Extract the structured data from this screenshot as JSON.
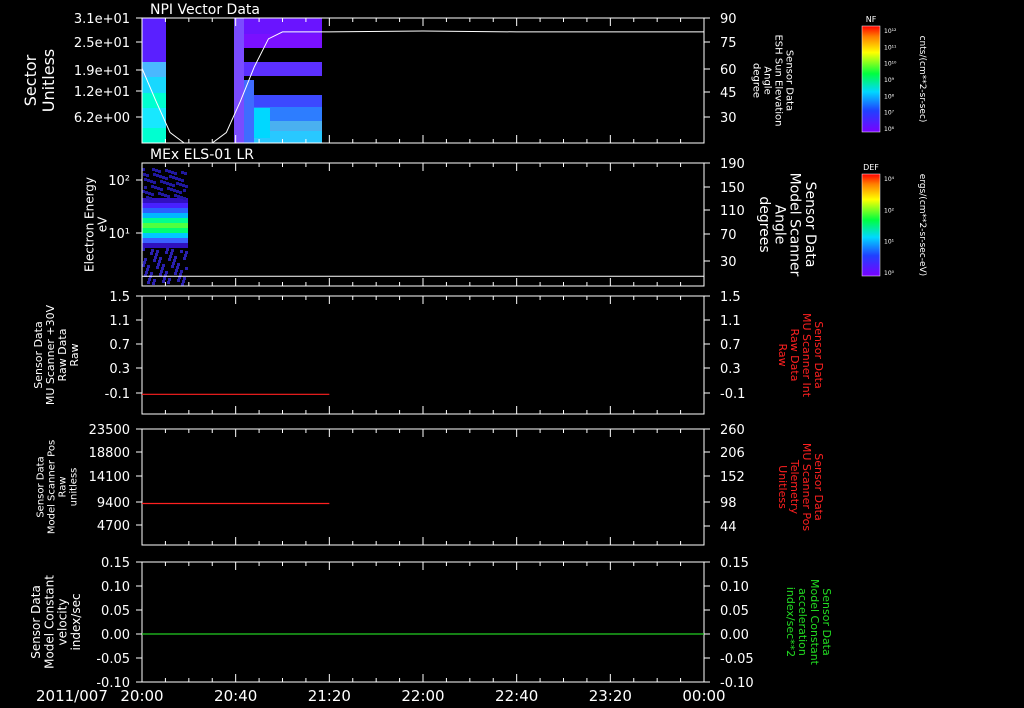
{
  "figure": {
    "date_label": "2011/007",
    "time_ticks": [
      "20:00",
      "20:40",
      "21:20",
      "22:00",
      "22:40",
      "23:20",
      "00:00"
    ]
  },
  "chart_data": [
    {
      "type": "heatmap",
      "title": "NPI Vector Data",
      "ylabel": [
        "Sector",
        "Unitless"
      ],
      "y_ticks": [
        "3.1e+01",
        "2.5e+01",
        "1.9e+01",
        "1.2e+01",
        "6.2e+00"
      ],
      "right_label": [
        "Sensor Data",
        "ESH Sun Elevation",
        "Angle",
        "degree"
      ],
      "right_ticks": [
        "90",
        "75",
        "60",
        "45",
        "30"
      ],
      "overlay_line": {
        "x": [
          "20:00",
          "20:06",
          "20:12",
          "20:18",
          "20:24",
          "20:30",
          "20:36",
          "20:42",
          "20:48",
          "20:54",
          "21:00",
          "21:20",
          "22:00",
          "22:40",
          "23:20",
          "00:00"
        ],
        "y": [
          61,
          42,
          24,
          18,
          18,
          18,
          24,
          42,
          62,
          78,
          82,
          82,
          82.5,
          82,
          82,
          82
        ],
        "ylim": [
          18,
          90
        ]
      },
      "colorbar": {
        "label": "NF",
        "units": "cnts/(cm**2-sr-sec)",
        "ticks": [
          "10¹²",
          "10¹¹",
          "10¹⁰",
          "10⁹",
          "10⁸",
          "10⁷",
          "10⁶"
        ]
      }
    },
    {
      "type": "heatmap",
      "title": "MEx ELS-01 LR",
      "ylabel": [
        "Electron Energy",
        "eV"
      ],
      "y_ticks": [
        "10²",
        "10¹"
      ],
      "right_label": [
        "Sensor Data",
        "Model Scanner",
        "Angle",
        "degrees"
      ],
      "right_ticks": [
        "190",
        "150",
        "110",
        "70",
        "30"
      ],
      "overlay_line": {
        "x": [
          "20:00",
          "00:00"
        ],
        "y": [
          15,
          15
        ],
        "ylim": [
          0,
          190
        ]
      },
      "colorbar": {
        "label": "DEF",
        "units": "ergs/(cm**2-sr-sec-eV)",
        "ticks": [
          "10⁴",
          "10²",
          "10¹",
          "10⁰"
        ]
      }
    },
    {
      "type": "line",
      "ylabel": [
        "Sensor Data",
        "MU Scanner +30V",
        "Raw Data",
        "Raw"
      ],
      "y_ticks": [
        "1.5",
        "1.1",
        "0.7",
        "0.3",
        "-0.1"
      ],
      "ylim": [
        -0.3,
        1.5
      ],
      "right_label": [
        "Sensor Data",
        "MU Scanner Int",
        "Raw Data",
        "Raw"
      ],
      "right_ticks": [
        "1.5",
        "1.1",
        "0.7",
        "0.3",
        "-0.1"
      ],
      "series": [
        {
          "x": [
            "20:00",
            "21:20"
          ],
          "y": [
            0.0,
            0.0
          ],
          "color": "#ff2020"
        }
      ]
    },
    {
      "type": "line",
      "ylabel": [
        "Sensor Data",
        "Model Scanner Pos",
        "Raw",
        "unitless"
      ],
      "y_ticks": [
        "23500",
        "18800",
        "14100",
        "9400",
        "4700"
      ],
      "ylim": [
        0,
        23500
      ],
      "right_label": [
        "Sensor Data",
        "MU Scanner Pos",
        "Telemetry",
        "Unitless"
      ],
      "right_ticks": [
        "260",
        "206",
        "152",
        "98",
        "44"
      ],
      "series": [
        {
          "x": [
            "20:00",
            "21:20"
          ],
          "y": [
            8400,
            8400
          ],
          "color": "#ff2020"
        }
      ]
    },
    {
      "type": "line",
      "ylabel": [
        "Sensor Data",
        "Model Constant",
        "velocity",
        "index/sec"
      ],
      "y_ticks": [
        "0.15",
        "0.10",
        "0.05",
        "0.00",
        "-0.05",
        "-0.10"
      ],
      "ylim": [
        -0.1,
        0.15
      ],
      "right_label": [
        "Sensor Data",
        "Model Constant",
        "acceleration",
        "index/sec**2"
      ],
      "right_ticks": [
        "0.15",
        "0.10",
        "0.05",
        "0.00",
        "-0.05",
        "-0.10"
      ],
      "series": [
        {
          "x": [
            "20:00",
            "00:00"
          ],
          "y": [
            0,
            0
          ],
          "color": "#22cc22"
        }
      ]
    }
  ],
  "colors": {
    "background": "#000000",
    "axis": "#ffffff",
    "right_label_red": "#ff2020",
    "right_label_green": "#22dd22"
  }
}
